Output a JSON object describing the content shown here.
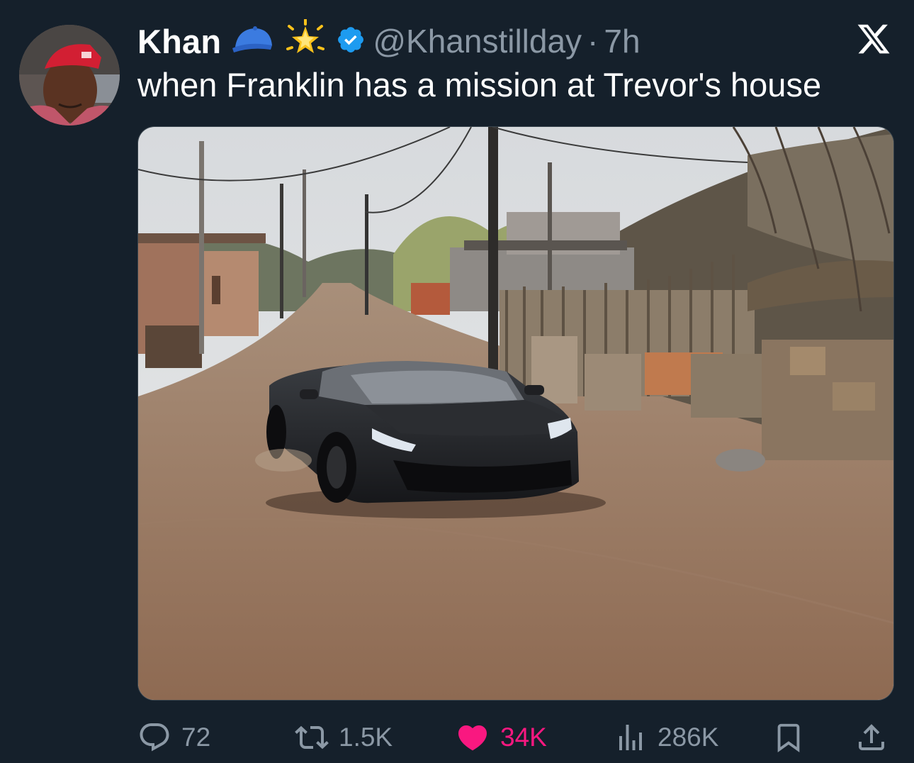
{
  "tweet": {
    "author_name": "Khan",
    "handle": "@Khanstillday",
    "separator": "·",
    "time": "7h",
    "name_emojis": [
      "blue-cap-icon",
      "glowing-star-icon"
    ],
    "verified_icon": "verified-badge-icon",
    "text": "when Franklin has a mission at Trevor's house"
  },
  "actions": {
    "reply_count": "72",
    "retweet_count": "1.5K",
    "like_count": "34K",
    "views_count": "286K"
  },
  "colors": {
    "background": "#15202b",
    "secondary_text": "#8b98a5",
    "like_active": "#f91880",
    "verified": "#1d9bf0"
  }
}
